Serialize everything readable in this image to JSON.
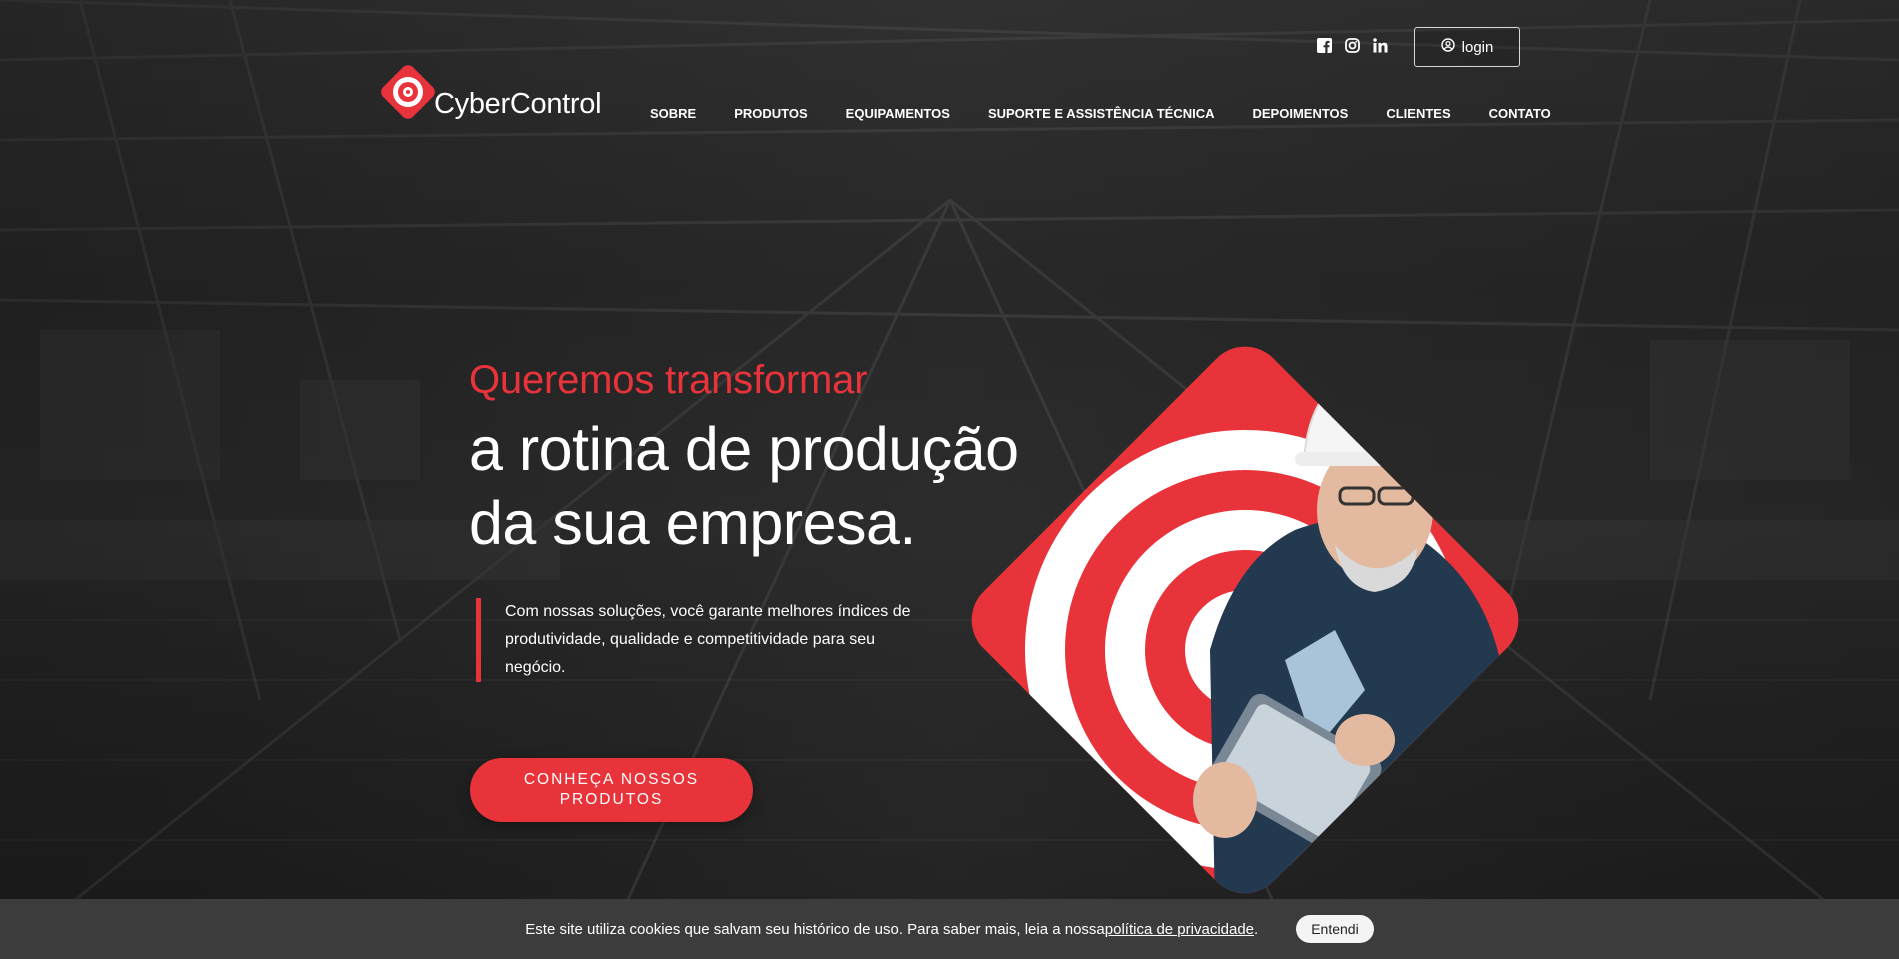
{
  "brand": {
    "name": "CyberControl",
    "accent": "#e8333a"
  },
  "header": {
    "social_icons": [
      "facebook-icon",
      "instagram-icon",
      "linkedin-icon"
    ],
    "login_label": "login",
    "nav": [
      {
        "label": "SOBRE"
      },
      {
        "label": "PRODUTOS"
      },
      {
        "label": "EQUIPAMENTOS"
      },
      {
        "label": "SUPORTE E ASSISTÊNCIA TÉCNICA"
      },
      {
        "label": "DEPOIMENTOS"
      },
      {
        "label": "CLIENTES"
      },
      {
        "label": "CONTATO"
      }
    ]
  },
  "hero": {
    "headline_red": "Queremos transformar",
    "headline_line1": "a rotina de produção",
    "headline_line2": "da sua empresa.",
    "description": "Com nossas soluções, você garante melhores índices de produtividade, qualidade e competitividade para seu negócio.",
    "cta_label": "CONHEÇA NOSSOS PRODUTOS"
  },
  "cookie_bar": {
    "text_before": "Este site utiliza cookies que salvam seu histórico de uso. Para saber mais, leia a nossa ",
    "link_label": "política de privacidade",
    "text_after": ".",
    "button_label": "Entendi"
  }
}
